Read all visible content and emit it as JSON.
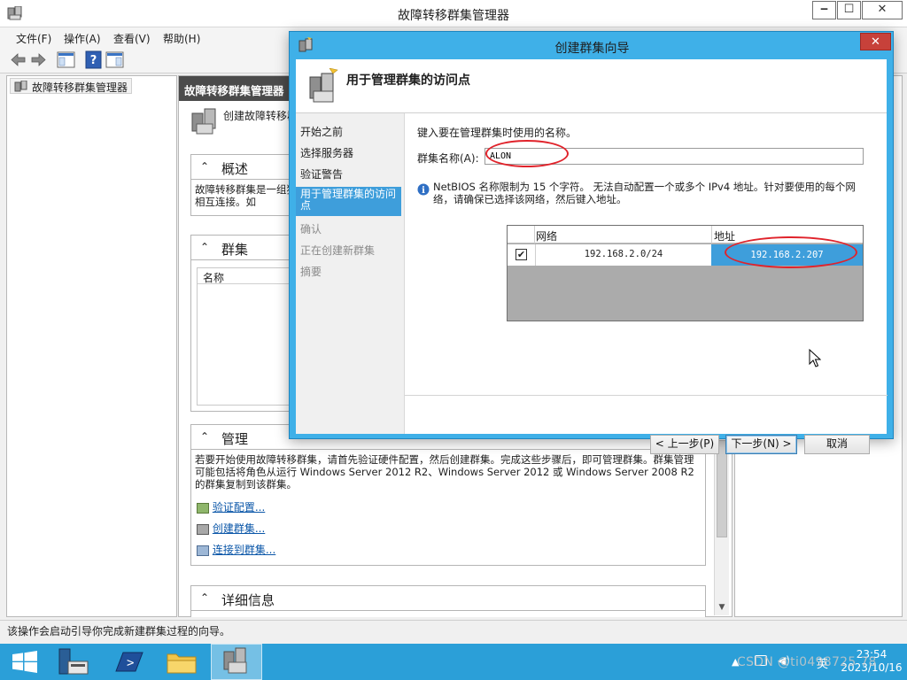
{
  "window": {
    "title": "故障转移群集管理器",
    "min_label": "‒",
    "max_label": "☐",
    "close_label": "✕"
  },
  "menu": [
    "文件(F)",
    "操作(A)",
    "查看(V)",
    "帮助(H)"
  ],
  "tree": {
    "root": "故障转移群集管理器"
  },
  "center": {
    "header": "故障转移群集管理器",
    "intro": "创建故障转移群",
    "overview": {
      "title": "概述",
      "text": "故障转移群集是一组独立计算机，它们协同工作以提高服务器角色的可用性。群集中的服务器由物理电缆和软件相互连接。如"
    },
    "clusters": {
      "title": "群集",
      "column_name": "名称"
    },
    "manage": {
      "title": "管理",
      "text": "若要开始使用故障转移群集，请首先验证硬件配置，然后创建群集。完成这些步骤后，即可管理群集。群集管理可能包括将角色从运行 Windows Server 2012 R2、Windows Server 2012 或 Windows Server 2008 R2 的群集复制到该群集。",
      "links": [
        "验证配置...",
        "创建群集...",
        "连接到群集..."
      ]
    },
    "details": {
      "title": "详细信息"
    }
  },
  "status_text": "该操作会启动引导你完成新建群集过程的向导。",
  "wizard": {
    "title": "创建群集向导",
    "close_label": "✕",
    "banner_title": "用于管理群集的访问点",
    "nav": [
      {
        "label": "开始之前",
        "state": "normal"
      },
      {
        "label": "选择服务器",
        "state": "normal"
      },
      {
        "label": "验证警告",
        "state": "normal"
      },
      {
        "label": "用于管理群集的访问点",
        "state": "active"
      },
      {
        "label": "确认",
        "state": "disabled"
      },
      {
        "label": "正在创建新群集",
        "state": "disabled"
      },
      {
        "label": "摘要",
        "state": "disabled"
      }
    ],
    "instruction": "键入要在管理群集时使用的名称。",
    "name_label": "群集名称(A):",
    "name_value": "ALON",
    "info_text": "NetBIOS 名称限制为 15 个字符。 无法自动配置一个或多个 IPv4 地址。针对要使用的每个网络，请确保已选择该网络，然后键入地址。",
    "grid": {
      "col_network": "网络",
      "col_address": "地址",
      "rows": [
        {
          "checked": true,
          "network": "192.168.2.0/24",
          "address": "192.168.2.207"
        }
      ]
    },
    "buttons": {
      "back": "< 上一步(P)",
      "next": "下一步(N) >",
      "cancel": "取消"
    }
  },
  "taskbar": {
    "time": "23:54",
    "date": "2023/10/16",
    "ime": "英",
    "watermark": "CSDN @ti0498725 78"
  },
  "colors": {
    "taskbar": "#2b9fd8",
    "selection": "#3e9edb",
    "highlight_ring": "#e0232b",
    "link": "#0a56a8"
  }
}
